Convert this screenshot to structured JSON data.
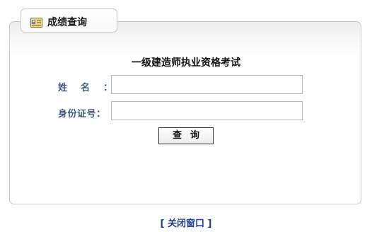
{
  "tab": {
    "icon": "id-card-icon",
    "title": "成绩查询"
  },
  "form": {
    "heading": "一级建造师执业资格考试",
    "name_label": "姓名",
    "id_label": "身份证号：",
    "colon": "：",
    "name_value": "",
    "id_value": "",
    "query_button": "查询"
  },
  "footer": {
    "close_link": "[ 关闭窗口 ]"
  },
  "colors": {
    "label": "#3a5e86",
    "link": "#1f3f8f",
    "border": "#c9c9c9"
  }
}
